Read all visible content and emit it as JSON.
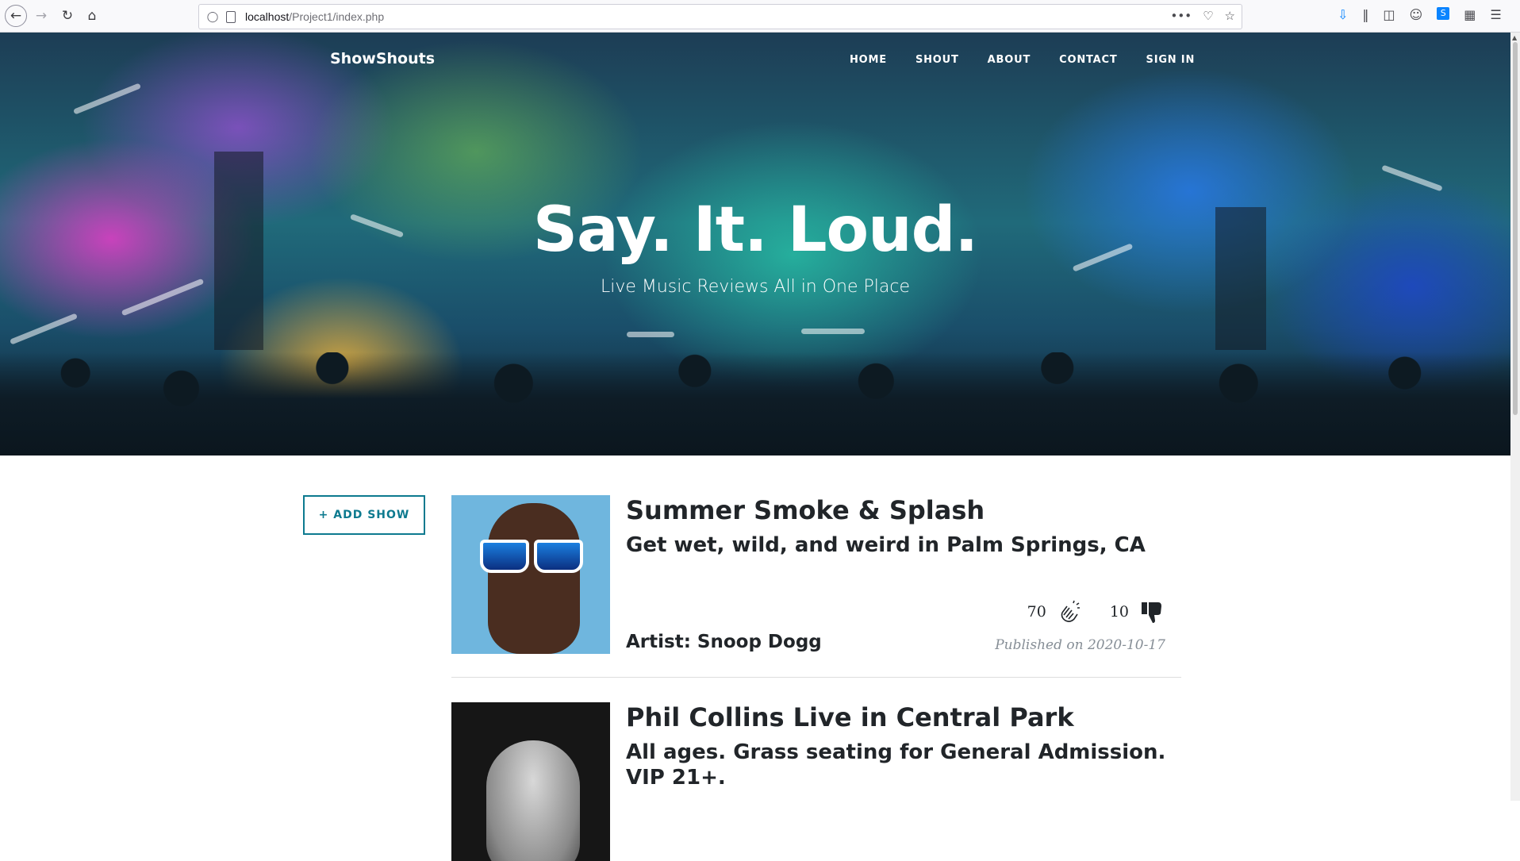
{
  "browser": {
    "url_host": "localhost",
    "url_path": "/Project1/index.php",
    "more_label": "•••"
  },
  "site": {
    "brand": "ShowShouts",
    "nav": [
      "HOME",
      "SHOUT",
      "ABOUT",
      "CONTACT",
      "SIGN IN"
    ]
  },
  "hero": {
    "title": "Say. It. Loud.",
    "subtitle": "Live Music Reviews All in One Place"
  },
  "actions": {
    "add_show": "+ ADD SHOW"
  },
  "posts": [
    {
      "title": "Summer Smoke & Splash",
      "subtitle": "Get wet, wild, and weird in Palm Springs, CA",
      "artist": "Artist: Snoop Dogg",
      "claps": "70",
      "dislikes": "10",
      "published": "Published on 2020-10-17"
    },
    {
      "title": "Phil Collins Live in Central Park",
      "subtitle": "All ages. Grass seating for General Admission. VIP 21+."
    }
  ],
  "colors": {
    "accent": "#0d7a8f",
    "text": "#212529",
    "muted": "#868e96"
  }
}
